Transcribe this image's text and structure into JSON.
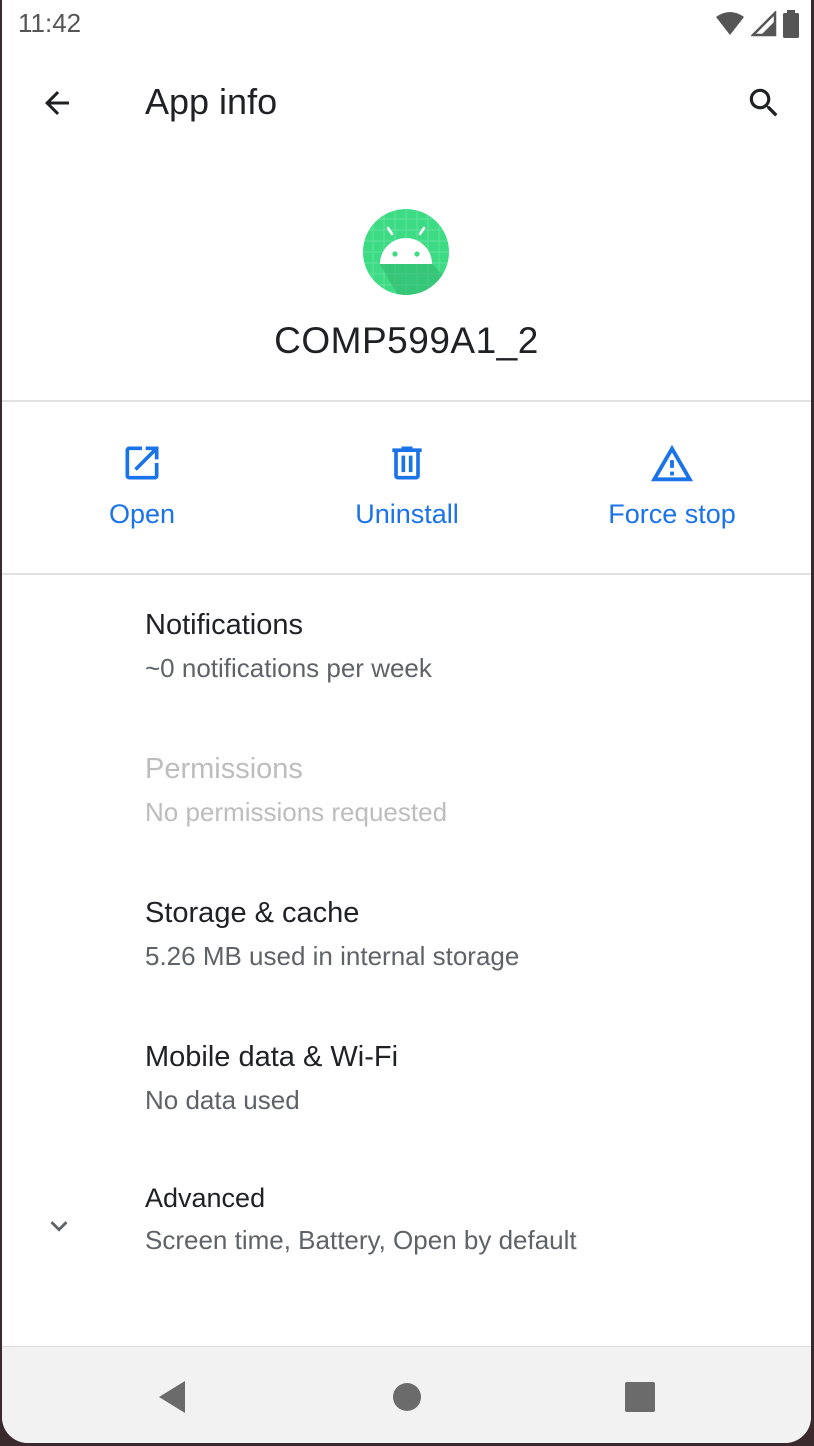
{
  "status_bar": {
    "time": "11:42"
  },
  "app_bar": {
    "title": "App info"
  },
  "app": {
    "name": "COMP599A1_2"
  },
  "actions": [
    {
      "label": "Open",
      "icon": "open-in-new-icon"
    },
    {
      "label": "Uninstall",
      "icon": "trash-icon"
    },
    {
      "label": "Force stop",
      "icon": "warning-icon"
    }
  ],
  "preferences": [
    {
      "title": "Notifications",
      "summary": "~0 notifications per week",
      "enabled": true
    },
    {
      "title": "Permissions",
      "summary": "No permissions requested",
      "enabled": false
    },
    {
      "title": "Storage & cache",
      "summary": "5.26 MB used in internal storage",
      "enabled": true
    },
    {
      "title": "Mobile data & Wi-Fi",
      "summary": "No data used",
      "enabled": true
    },
    {
      "title": "Advanced",
      "summary": "Screen time, Battery, Open by default",
      "enabled": true,
      "expandable": true
    }
  ],
  "colors": {
    "accent": "#1a73e8",
    "app_icon_bg": "#3ddc84",
    "disabled_text": "#bdbdbd"
  }
}
